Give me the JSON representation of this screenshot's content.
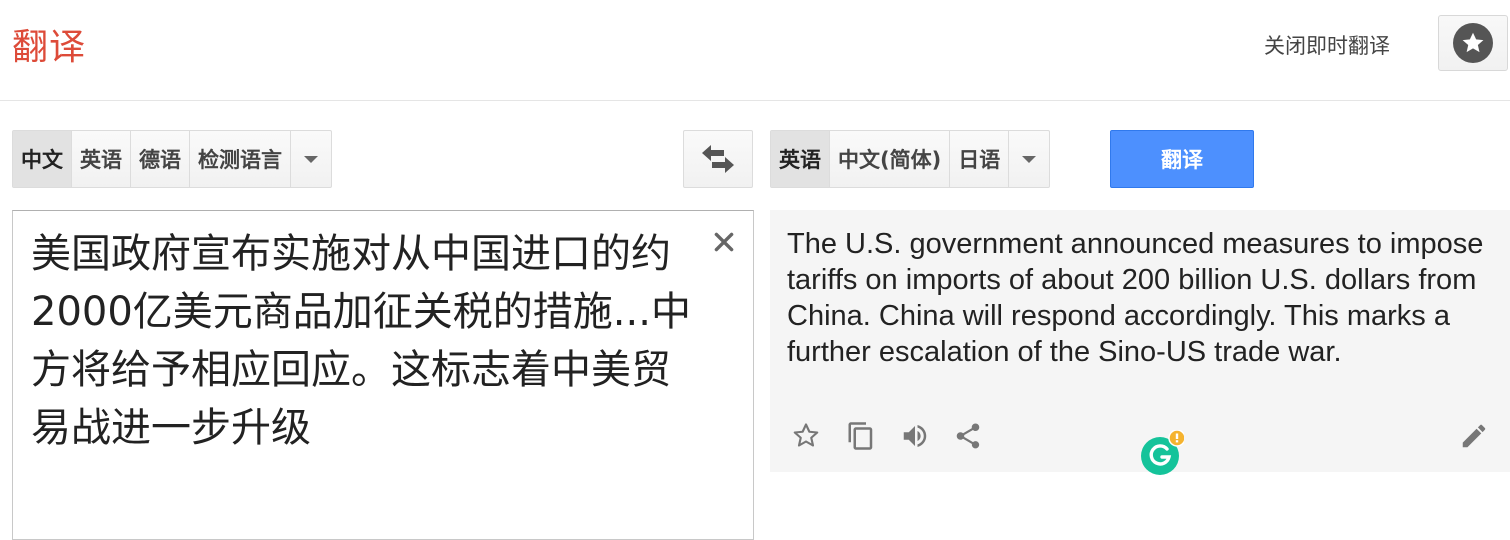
{
  "header": {
    "title": "翻译",
    "instant_toggle_label": "关闭即时翻译"
  },
  "source_langs": {
    "items": [
      "中文",
      "英语",
      "德语",
      "检测语言"
    ],
    "selected": "中文"
  },
  "target_langs": {
    "items": [
      "英语",
      "中文(简体)",
      "日语"
    ],
    "selected": "英语"
  },
  "translate_button": "翻译",
  "source": {
    "text": "美国政府宣布实施对从中国进口的约2000亿美元商品加征关税的措施...中方将给予相应回应。这标志着中美贸易战进一步升级"
  },
  "result": {
    "text": "The U.S. government announced measures to impose tariffs on imports of about 200 billion U.S. dollars from China. China will respond accordingly. This marks a further escalation of the Sino-US trade war."
  },
  "icons": {
    "star": "star-outline-icon",
    "copy": "copy-icon",
    "listen": "speaker-icon",
    "share": "share-icon",
    "edit": "pencil-icon",
    "extension": "grammarly-icon"
  },
  "colors": {
    "title": "#dd4b39",
    "translate_button": "#4d90fe",
    "result_background": "#f5f5f5",
    "grammarly": "#15c39a",
    "grammarly_badge": "#f5b32f"
  }
}
